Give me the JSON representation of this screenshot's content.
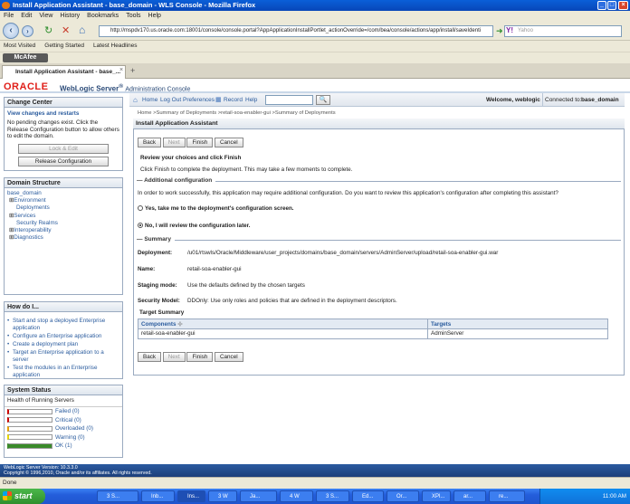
{
  "window": {
    "title": "Install Application Assistant - base_domain - WLS Console - Mozilla Firefox"
  },
  "menu": [
    "File",
    "Edit",
    "View",
    "History",
    "Bookmarks",
    "Tools",
    "Help"
  ],
  "nav": {
    "url": "http://mspdv170.us.oracle.com:18001/console/console.portal?AppApplicationInstallPortlet_actionOverride=/com/bea/console/actions/app/install/saveIdenti",
    "search_placeholder": "Yahoo"
  },
  "bookmarks": [
    "Most Visited",
    "Getting Started",
    "Latest Headlines"
  ],
  "mcafee": "McAfee",
  "tab": {
    "label": "Install Application Assistant - base_...",
    "new_tab": "+"
  },
  "brand": {
    "oracle": "ORACLE",
    "product": "WebLogic Server",
    "reg": "®",
    "console": "Administration Console"
  },
  "toolbar": {
    "home": "Home",
    "logout": "Log Out",
    "preferences": "Preferences",
    "record": "Record",
    "help": "Help",
    "welcome": "Welcome, weblogic",
    "connected": "Connected to:",
    "domain": "base_domain"
  },
  "breadcrumb": "Home >Summary of Deployments >retail-soa-enabler-gui >Summary of Deployments",
  "change_center": {
    "title": "Change Center",
    "link": "View changes and restarts",
    "text": "No pending changes exist. Click the Release Configuration button to allow others to edit the domain.",
    "lock_btn": "Lock & Edit",
    "release_btn": "Release Configuration"
  },
  "domain_structure": {
    "title": "Domain Structure",
    "items": [
      "base_domain",
      "Environment",
      "Deployments",
      "Services",
      "Security Realms",
      "Interoperability",
      "Diagnostics"
    ]
  },
  "how_do_i": {
    "title": "How do I...",
    "items": [
      "Start and stop a deployed Enterprise application",
      "Configure an Enterprise application",
      "Create a deployment plan",
      "Target an Enterprise application to a server",
      "Test the modules in an Enterprise application"
    ]
  },
  "system_status": {
    "title": "System Status",
    "subtitle": "Health of Running Servers",
    "rows": [
      {
        "label": "Failed (0)",
        "color": "#cc0000",
        "fill": 0
      },
      {
        "label": "Critical (0)",
        "color": "#cc0000",
        "fill": 0
      },
      {
        "label": "Overloaded (0)",
        "color": "#e8a000",
        "fill": 0
      },
      {
        "label": "Warning (0)",
        "color": "#e8d800",
        "fill": 0
      },
      {
        "label": "OK (1)",
        "color": "#3a8a2a",
        "fill": 1
      }
    ]
  },
  "assistant": {
    "title": "Install Application Assistant",
    "buttons": {
      "back": "Back",
      "next": "Next",
      "finish": "Finish",
      "cancel": "Cancel"
    },
    "heading": "Review your choices and click Finish",
    "subtext": "Click Finish to complete the deployment. This may take a few moments to complete.",
    "additional_title": "Additional configuration",
    "additional_text": "In order to work successfully, this application may require additional configuration. Do you want to review this application's configuration after completing this assistant?",
    "option_yes": "Yes, take me to the deployment's configuration screen.",
    "option_no": "No, I will review the configuration later.",
    "summary_title": "Summary",
    "deployment_label": "Deployment:",
    "deployment_value": "/u01/rtswls/Oracle/Middleware/user_projects/domains/base_domain/servers/AdminServer/upload/retail-soa-enabler-gui.war",
    "name_label": "Name:",
    "name_value": "retail-soa-enabler-gui",
    "staging_label": "Staging mode:",
    "staging_value": "Use the defaults defined by the chosen targets",
    "security_label": "Security Model:",
    "security_value": "DDOnly: Use only roles and policies that are defined in the deployment descriptors.",
    "target_summary_title": "Target Summary",
    "table": {
      "headers": [
        "Components",
        "Targets"
      ],
      "rows": [
        [
          "retail-soa-enabler-gui",
          "AdminServer"
        ]
      ]
    }
  },
  "footer": {
    "version": "WebLogic Server Version: 10.3.3.0",
    "copyright": "Copyright © 1996,2010, Oracle and/or its affiliates. All rights reserved."
  },
  "statusline": "Done",
  "taskbar": {
    "start": "start",
    "items": [
      "3 S...",
      "Inb...",
      "Ins...",
      "3 W",
      "Ja...",
      "4 W",
      "3 S...",
      "Ed...",
      "Or...",
      "XPl...",
      "ar...",
      "re..."
    ],
    "clock": "11:00 AM"
  }
}
